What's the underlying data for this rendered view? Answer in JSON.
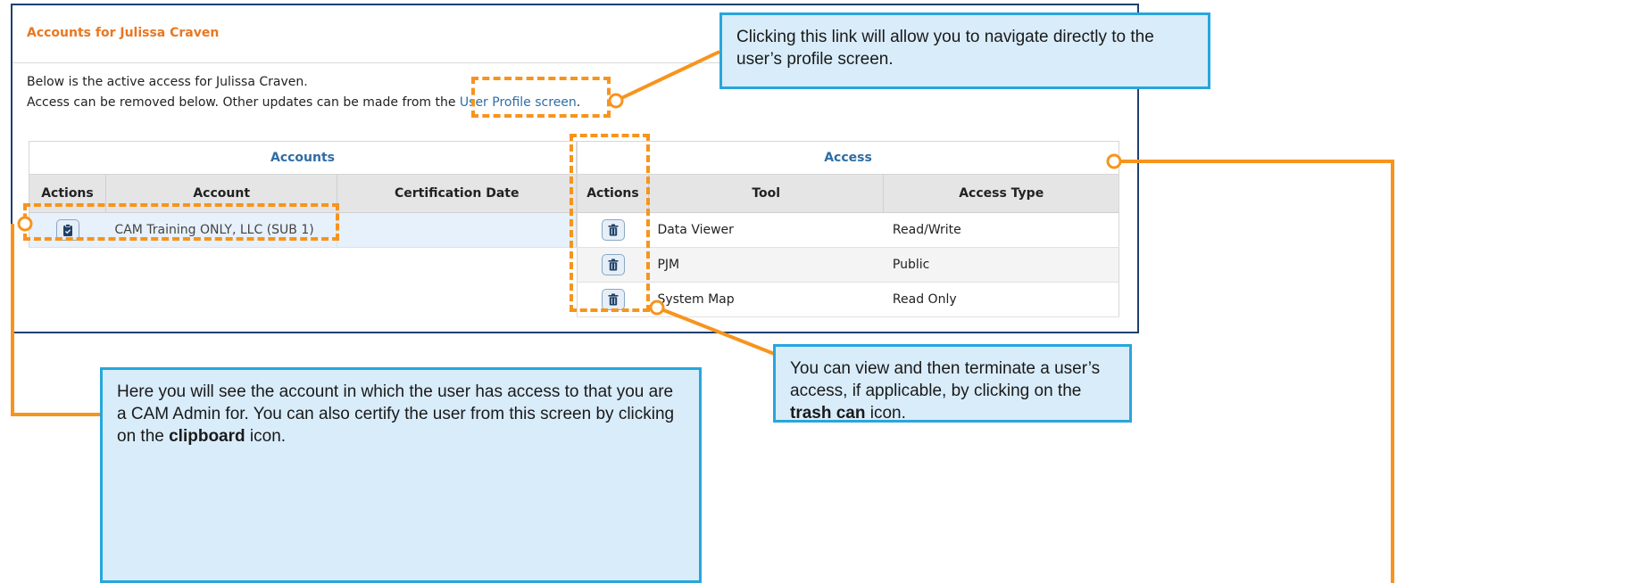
{
  "panel": {
    "title": "Accounts for Julissa Craven",
    "intro_line1": "Below is the active access for Julissa Craven.",
    "intro_line2_prefix": "Access can be removed below. Other updates can be made from the ",
    "profile_link": "User Profile screen",
    "intro_line2_suffix": "."
  },
  "accounts_table": {
    "group_header": "Accounts",
    "columns": [
      "Actions",
      "Account",
      "Certification Date"
    ],
    "rows": [
      {
        "action_icon": "clipboard-icon",
        "account": "CAM Training ONLY, LLC (SUB 1)",
        "certification_date": ""
      }
    ]
  },
  "access_table": {
    "group_header": "Access",
    "columns": [
      "Actions",
      "Tool",
      "Access Type"
    ],
    "rows": [
      {
        "action_icon": "trash-icon",
        "tool": "Data Viewer",
        "access_type": "Read/Write"
      },
      {
        "action_icon": "trash-icon",
        "tool": "PJM",
        "access_type": "Public"
      },
      {
        "action_icon": "trash-icon",
        "tool": "System Map",
        "access_type": "Read Only"
      }
    ]
  },
  "callouts": {
    "profile_link": "Clicking this link will allow you to navigate directly to the user’s profile screen.",
    "trash": {
      "pre": "You can view and then terminate a user’s access, if applicable, by clicking on the ",
      "bold": "trash can",
      "post": " icon."
    },
    "clipboard": {
      "pre": "Here you will see the account in which the user has access to that you are a CAM Admin for. You can also certify the user from this screen by clicking on the ",
      "bold": "clipboard",
      "post": " icon."
    }
  },
  "colors": {
    "panel_border": "#1f3f6e",
    "title_orange": "#e87722",
    "link_blue": "#2e6da4",
    "callout_fill": "#d9ecfa",
    "callout_border": "#27a6dc",
    "annotation_orange": "#f7941d"
  }
}
